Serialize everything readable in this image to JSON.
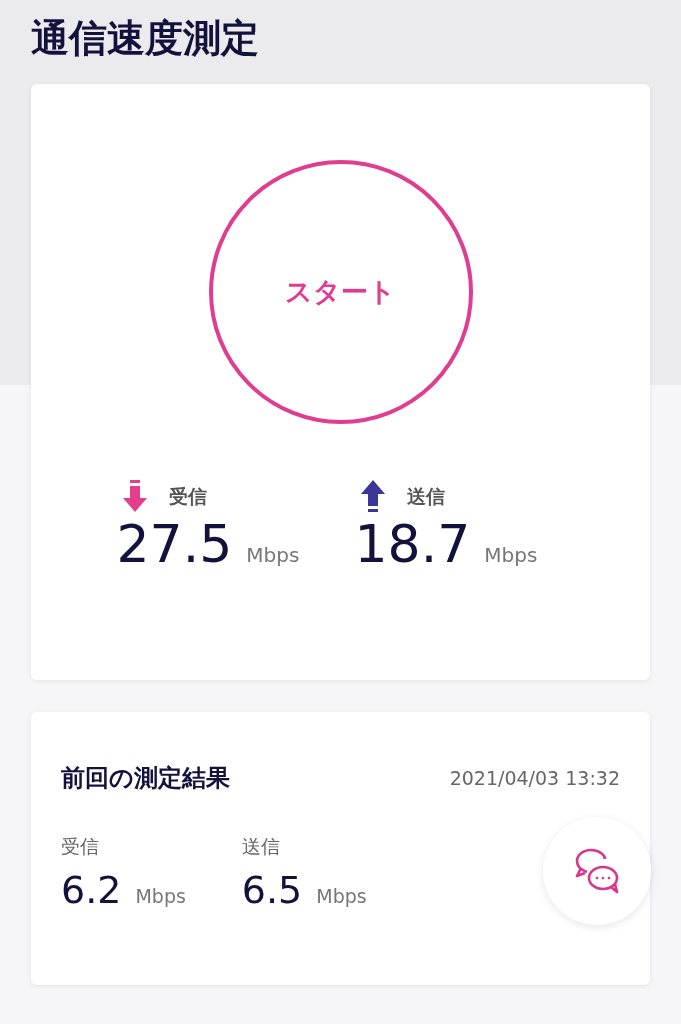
{
  "title": "通信速度測定",
  "start_button": "スタート",
  "current": [
    {
      "kind": "download",
      "label": "受信",
      "value": "27.5",
      "unit": "Mbps"
    },
    {
      "kind": "upload",
      "label": "送信",
      "value": "18.7",
      "unit": "Mbps"
    }
  ],
  "previous": {
    "title": "前回の測定結果",
    "datetime": "2021/04/03 13:32",
    "results": [
      {
        "label": "受信",
        "value": "6.2",
        "unit": "Mbps"
      },
      {
        "label": "送信",
        "value": "6.5",
        "unit": "Mbps"
      }
    ]
  }
}
